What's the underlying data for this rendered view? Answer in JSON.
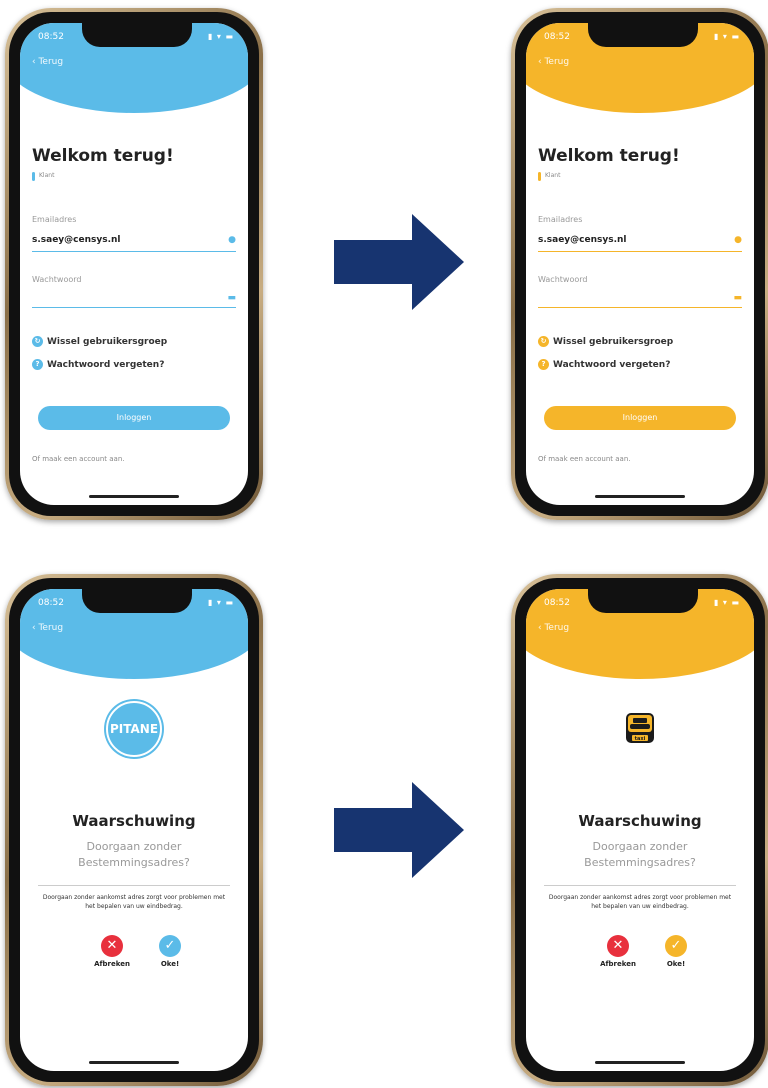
{
  "status": {
    "time": "08:52",
    "icons": "▮ ▾ ▬"
  },
  "colors": {
    "blue": "#5bbbe8",
    "yellow": "#f5b52a",
    "arrow": "#173470",
    "red": "#e8303d"
  },
  "login_blue": {
    "back": "‹ Terug",
    "title": "Welkom terug!",
    "accent_text": "Klant",
    "email_label": "Emailadres",
    "email_value": "s.saey@censys.nl",
    "password_label": "Wachtwoord",
    "switch_group": "Wissel gebruikersgroep",
    "forgot": "Wachtwoord vergeten?",
    "login_button": "Inloggen",
    "account_link": "Of maak een account aan."
  },
  "login_yellow": {
    "back": "‹ Terug",
    "title": "Welkom terug!",
    "accent_text": "Klant",
    "email_label": "Emailadres",
    "email_value": "s.saey@censys.nl",
    "password_label": "Wachtwoord",
    "switch_group": "Wissel gebruikersgroep",
    "forgot": "Wachtwoord vergeten?",
    "login_button": "Inloggen",
    "account_link": "Of maak een account aan."
  },
  "warning_blue": {
    "back": "‹ Terug",
    "logo_text": "PITANE",
    "title": "Waarschuwing",
    "subtitle": "Doorgaan zonder Bestemmingsadres?",
    "body": "Doorgaan zonder aankomst adres zorgt voor problemen met het bepalen van uw eindbedrag.",
    "cancel": "Afbreken",
    "ok": "Oke!"
  },
  "warning_yellow": {
    "back": "‹ Terug",
    "logo_text": "taxi",
    "title": "Waarschuwing",
    "subtitle": "Doorgaan zonder Bestemmingsadres?",
    "body": "Doorgaan zonder aankomst adres zorgt voor problemen met het bepalen van uw eindbedrag.",
    "cancel": "Afbreken",
    "ok": "Oke!"
  }
}
